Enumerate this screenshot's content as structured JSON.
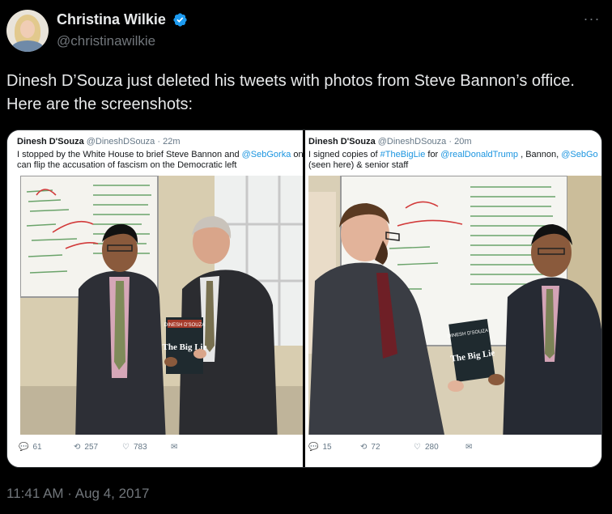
{
  "author": {
    "display_name": "Christina Wilkie",
    "handle": "@christinawilkie",
    "verified": true,
    "avatar_icon": "profile-photo"
  },
  "tweet": {
    "text": "Dinesh D’Souza just deleted his tweets with photos from Steve Bannon’s office. Here are the screenshots:",
    "timestamp": "11:41 AM · Aug 4, 2017"
  },
  "screenshots": [
    {
      "name": "Dinesh D'Souza",
      "handle": "@DineshDSouza",
      "time": "· 22m",
      "text_pre": "I stopped by the White House to brief Steve Bannon and ",
      "text_link": "@SebGorka",
      "text_post": " on how Trump can flip the accusation of fascism on the Democratic left",
      "book_title": "DINESH D'SOUZA",
      "book_subtitle": "The Big Lie",
      "replies": "61",
      "retweets": "257",
      "likes": "783"
    },
    {
      "name": "Dinesh D'Souza",
      "handle": "@DineshDSouza",
      "time": "· 20m",
      "text_pre": "I signed copies of ",
      "text_link": "#TheBigLie",
      "text_mid": " for ",
      "text_link2": "@realDonaldTrump",
      "text_mid2": " , Bannon, ",
      "text_link3": "@SebGo",
      "text_post": "(seen here) & senior staff",
      "book_title": "DINESH D'SOUZA",
      "book_subtitle": "The Big Lie",
      "replies": "15",
      "retweets": "72",
      "likes": "280"
    }
  ],
  "colors": {
    "background": "#000000",
    "text": "#e7e9ea",
    "secondary": "#71767b",
    "verified": "#1d9bf0",
    "link": "#1b95e0"
  }
}
